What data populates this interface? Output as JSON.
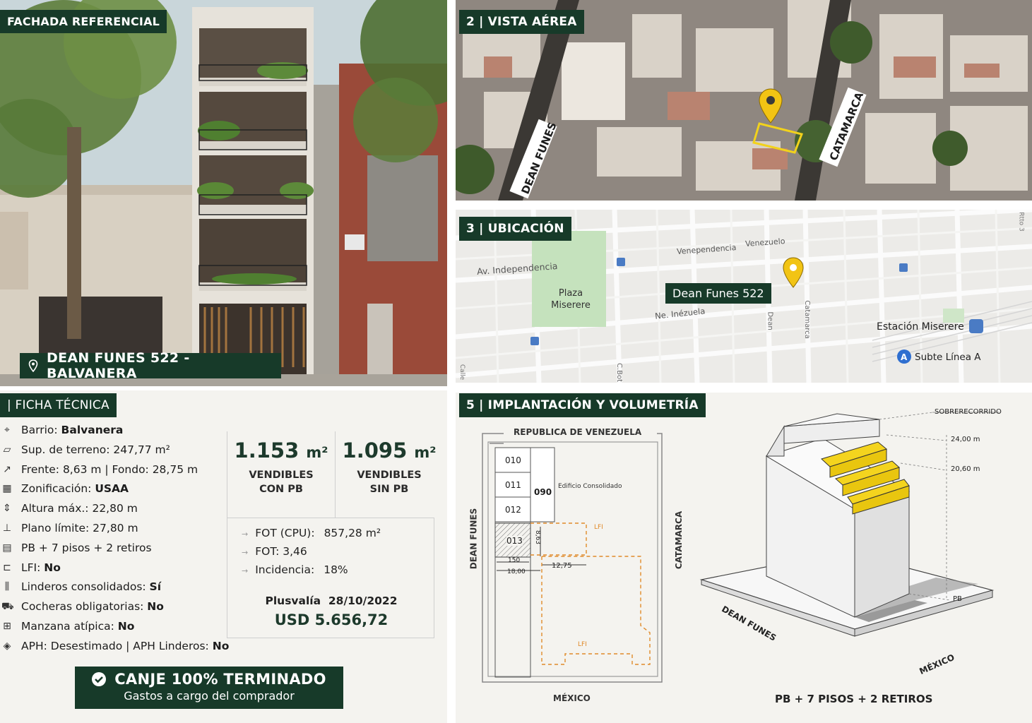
{
  "facade": {
    "tag": "FACHADA REFERENCIAL",
    "address": "DEAN FUNES 522 - BALVANERA",
    "pin_icon": "location-pin-icon"
  },
  "aerial": {
    "tag": "2 | VISTA AÉREA",
    "street_left": "DEAN FUNES",
    "street_right": "CATAMARCA",
    "pin_icon": "location-pin-icon"
  },
  "map": {
    "tag": "3 | UBICACIÓN",
    "plaza": [
      "Plaza",
      "Miserere"
    ],
    "pin_label": "Dean Funes 522",
    "streets": {
      "independencia": "Av. Independencia",
      "venepend": "Venependencia",
      "venezuela_top": "Venezuelo",
      "venezuela_low": "Ne. Inézuela",
      "catamarca": "Catamarca",
      "dean": "Dean",
      "cbot": "C.Bot",
      "calle_left": "Calle",
      "top_right": "Rtto 3"
    },
    "station": "Estación Miserere",
    "subte_badge": "A",
    "subte": "Subte Línea A"
  },
  "ficha": {
    "tag": "| FICHA TÉCNICA",
    "specs": [
      {
        "icon": "pin-outline-icon",
        "label": "Barrio: ",
        "value": "Balvanera"
      },
      {
        "icon": "area-icon",
        "label": "Sup. de terreno: 247,77 m²",
        "value": ""
      },
      {
        "icon": "dimension-arrow-icon",
        "label": "Frente: 8,63 m | Fondo: 28,75 m",
        "value": ""
      },
      {
        "icon": "buildings-icon",
        "label": "Zonificación: ",
        "value": "USAA"
      },
      {
        "icon": "height-icon",
        "label": "Altura máx.: 22,80 m",
        "value": ""
      },
      {
        "icon": "plane-limit-icon",
        "label": "Plano límite: 27,80 m",
        "value": ""
      },
      {
        "icon": "floors-icon",
        "label": "PB + 7 pisos + 2 retiros",
        "value": ""
      },
      {
        "icon": "lfi-icon",
        "label": "LFI: ",
        "value": "No"
      },
      {
        "icon": "neighbors-icon",
        "label": "Linderos consolidados: ",
        "value": "Sí"
      },
      {
        "icon": "car-icon",
        "label": "Cocheras obligatorias: ",
        "value": "No"
      },
      {
        "icon": "block-icon",
        "label": "Manzana atípica: ",
        "value": "No"
      },
      {
        "icon": "heritage-icon",
        "label": "APH: Desestimado | APH Linderos: ",
        "value": "No"
      }
    ],
    "vend_con": {
      "num": "1.153",
      "unit": "m²",
      "line1": "VENDIBLES",
      "line2": "CON PB"
    },
    "vend_sin": {
      "num": "1.095",
      "unit": "m²",
      "line1": "VENDIBLES",
      "line2": "SIN PB"
    },
    "fot_rows": [
      {
        "label": "FOT (CPU):",
        "value": "857,28 m²"
      },
      {
        "label": "FOT: 3,46",
        "value": ""
      },
      {
        "label": "Incidencia:",
        "value": "18%"
      }
    ],
    "plusvalia_label": "Plusvalía  28/10/2022",
    "plusvalia_value": "USD 5.656,72",
    "canje_title": "CANJE 100% TERMINADO",
    "canje_sub": "Gastos a cargo del comprador",
    "check_icon": "check-icon"
  },
  "impl": {
    "tag": "5 | IMPLANTACIÓN Y VOLUMETRÍA",
    "plan": {
      "top_street": "REPUBLICA DE VENEZUELA",
      "left_street": "DEAN FUNES",
      "right_street": "CATAMARCA",
      "bottom_street": "MÉXICO",
      "lots": [
        "010",
        "011",
        "012",
        "013"
      ],
      "lot_090": "090",
      "consolidado": "Edificio Consolidado",
      "dim_depth": "8,63",
      "dim_150": "150",
      "dim_1800": "18,00",
      "dim_1275": "12,75",
      "lfi_top": "LFI",
      "lfi_bottom": "LFI"
    },
    "volume": {
      "sobrerecorrido": "SOBRERECORRIDO",
      "h24": "24,00 m",
      "h2060": "20,60 m",
      "pb": "PB",
      "street_dean": "DEAN FUNES",
      "street_mexico": "MÉXICO",
      "caption": "PB + 7 PISOS + 2 RETIROS"
    }
  }
}
